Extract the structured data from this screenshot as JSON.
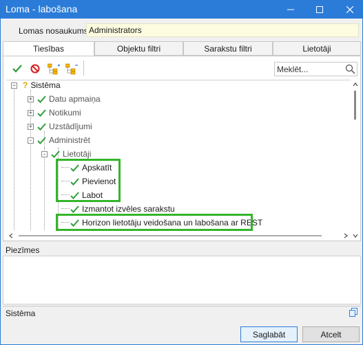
{
  "window": {
    "title": "Loma - labošana"
  },
  "name_field": {
    "label": "Lomas nosaukums:",
    "value": "Administrators"
  },
  "tabs": [
    {
      "label": "Tiesības",
      "active": true
    },
    {
      "label": "Objektu filtri",
      "active": false
    },
    {
      "label": "Sarakstu filtri",
      "active": false
    },
    {
      "label": "Lietotāji",
      "active": false
    }
  ],
  "toolbar": {
    "icons": [
      "check-icon",
      "deny-icon",
      "expand-all-icon",
      "collapse-all-icon"
    ],
    "search_placeholder": "Meklēt..."
  },
  "tree": {
    "root": {
      "label": "Sistēma",
      "icon": "question-icon"
    },
    "items": [
      {
        "label": "Datu apmaiņa",
        "icon": "check-icon",
        "expander": "+"
      },
      {
        "label": "Notikumi",
        "icon": "check-icon",
        "expander": "+"
      },
      {
        "label": "Uzstādījumi",
        "icon": "check-icon",
        "expander": "+"
      },
      {
        "label": "Administrēt",
        "icon": "check-icon",
        "expander": "-"
      },
      {
        "label": "Lietotāji",
        "icon": "check-icon",
        "expander": "-"
      },
      {
        "label": "Apskatīt",
        "icon": "check-icon",
        "highlighted": true
      },
      {
        "label": "Pievienot",
        "icon": "check-icon",
        "highlighted": true
      },
      {
        "label": "Labot",
        "icon": "check-icon",
        "highlighted": true
      },
      {
        "label": "Izmantot izvēles sarakstu",
        "icon": "check-icon",
        "highlighted": false
      },
      {
        "label": "Horizon lietotāju veidošana un labošana ar REST",
        "icon": "check-icon",
        "highlighted": true
      }
    ]
  },
  "notes": {
    "label": "Piezīmes",
    "value": ""
  },
  "status": {
    "text": "Sistēma"
  },
  "buttons": {
    "save": "Saglabāt",
    "cancel": "Atcelt"
  },
  "colors": {
    "titlebar": "#2b7cd8",
    "check": "#2e9e3a",
    "highlight": "#34b52a",
    "deny": "#d42020",
    "name_field_bg": "#fdfce0"
  }
}
